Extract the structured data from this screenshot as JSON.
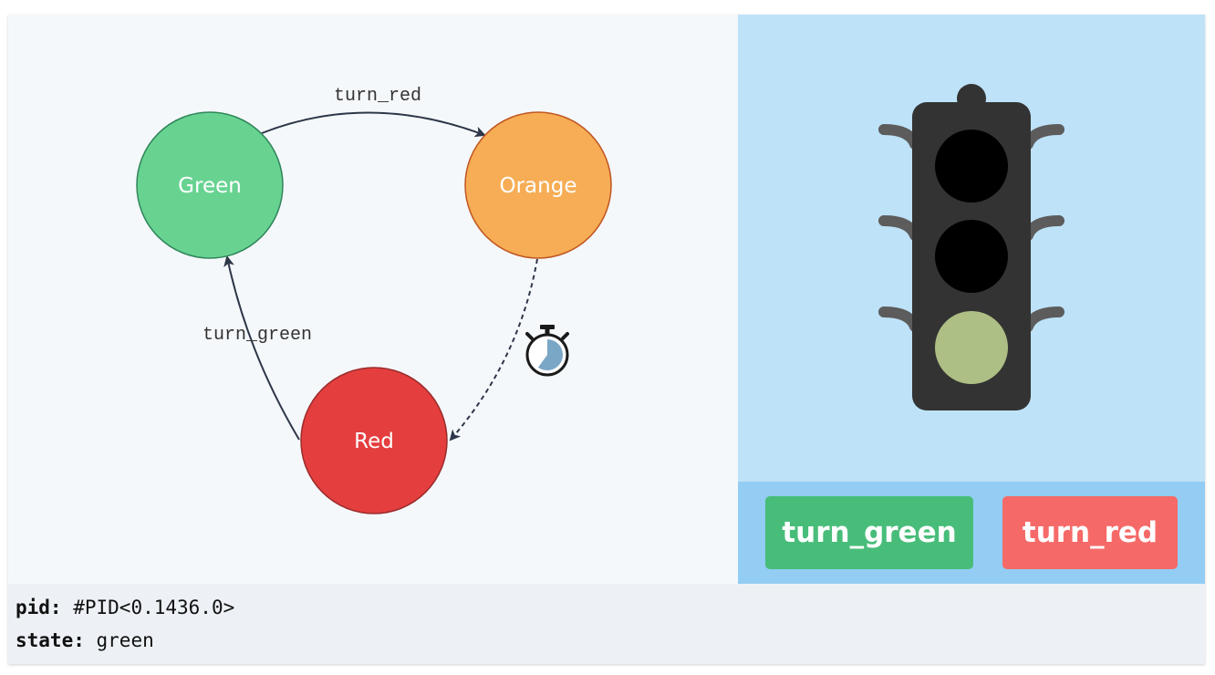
{
  "colors": {
    "green_state": "#68d391",
    "orange_state": "#f6ad55",
    "red_state": "#e53e3e",
    "diagram_bg": "#f5f8fb",
    "light_panel_bg": "#bee2f8",
    "controls_bg": "#93cdf3",
    "green_button": "#48bd7a",
    "red_button": "#f56a68",
    "active_lamp": "#adbf84",
    "status_bg": "#edf1f5"
  },
  "state_diagram": {
    "nodes": {
      "green": "Green",
      "orange": "Orange",
      "red": "Red"
    },
    "edges": {
      "green_to_orange": "turn_red",
      "red_to_green": "turn_green"
    },
    "timer_icon": "stopwatch-icon"
  },
  "traffic_light": {
    "lamps": [
      "red",
      "orange",
      "green"
    ],
    "active_lamp": "green"
  },
  "controls": {
    "turn_green_label": "turn_green",
    "turn_red_label": "turn_red"
  },
  "status": {
    "pid_label": "pid:",
    "pid_value": "#PID<0.1436.0>",
    "state_label": "state:",
    "state_value": "green"
  }
}
